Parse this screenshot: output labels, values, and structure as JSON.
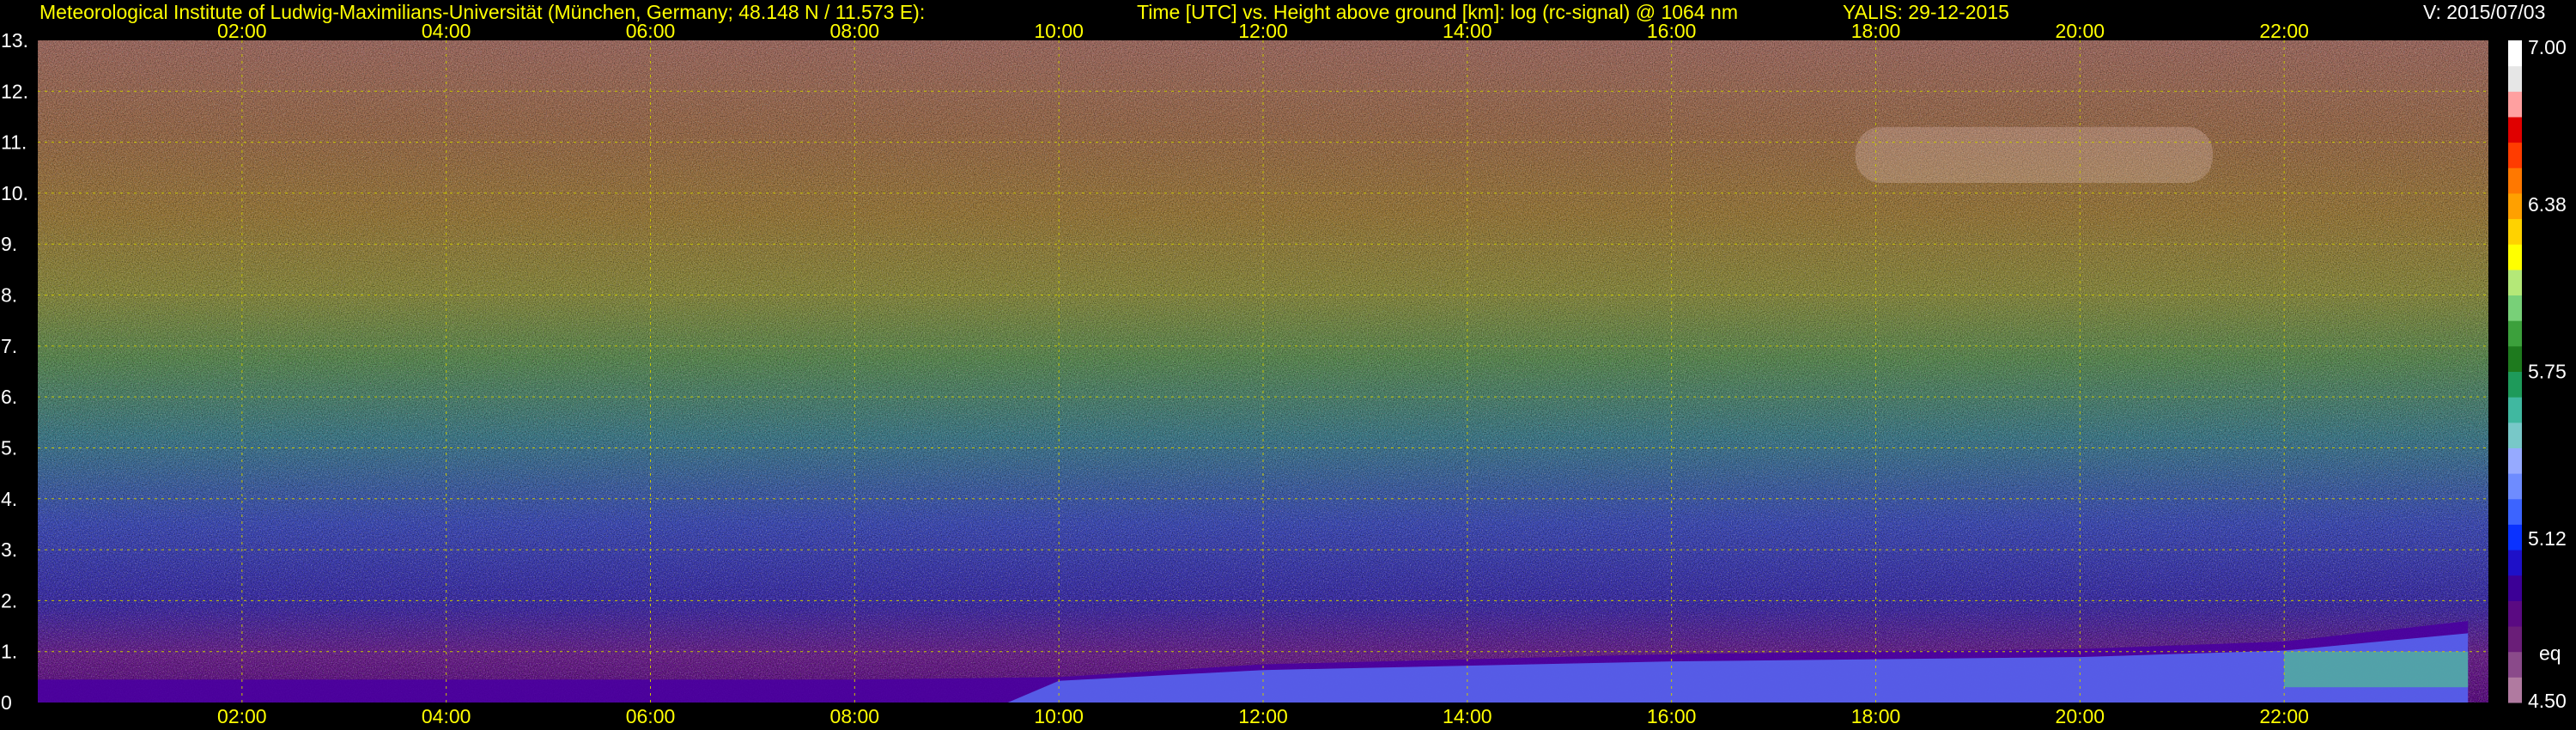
{
  "header": {
    "institute": "Meteorological Institute of Ludwig-Maximilians-Universität (München, Germany; 48.148 N / 11.573 E):",
    "plot_desc": "Time [UTC] vs. Height above ground [km]: log (rc-signal) @ 1064 nm",
    "station_date": "YALIS: 29-12-2015",
    "version": "V: 2015/07/03"
  },
  "colors": {
    "header_text": "#ffff00",
    "axis_text": "#ffffff",
    "grid": "#c8c800",
    "background": "#000000"
  },
  "chart_data": {
    "type": "heatmap",
    "title": "Time [UTC] vs. Height above ground [km]: log (rc-signal) @ 1064 nm",
    "xlabel": "Time [UTC]",
    "ylabel": "Height above ground [km]",
    "x_ticks": [
      "02:00",
      "04:00",
      "06:00",
      "08:00",
      "10:00",
      "12:00",
      "14:00",
      "16:00",
      "18:00",
      "20:00",
      "22:00"
    ],
    "x_tick_hours": [
      2,
      4,
      6,
      8,
      10,
      12,
      14,
      16,
      18,
      20,
      22
    ],
    "xlim_hours": [
      0,
      24
    ],
    "y_ticks": [
      "0",
      "1.",
      "2.",
      "3.",
      "4.",
      "5.",
      "6.",
      "7.",
      "8.",
      "9.",
      "10.",
      "11.",
      "12.",
      "13."
    ],
    "y_tick_values": [
      0,
      1,
      2,
      3,
      4,
      5,
      6,
      7,
      8,
      9,
      10,
      11,
      12,
      13
    ],
    "ylim_km": [
      0,
      13
    ],
    "grid": true,
    "colorbar": {
      "range": [
        4.5,
        7.0
      ],
      "tick_labels": [
        "7.00",
        "6.38",
        "5.75",
        "5.12",
        "4.50"
      ],
      "tick_values": [
        7.0,
        6.38,
        5.75,
        5.12,
        4.5
      ],
      "extra_label": "eq",
      "extra_value": 4.66,
      "colors": [
        "#b07aa0",
        "#8a4a8a",
        "#6a1e78",
        "#5a0a82",
        "#3c0096",
        "#1e10c8",
        "#0a32ff",
        "#3c64ff",
        "#6e8cff",
        "#96aaff",
        "#78c8c8",
        "#40b8a0",
        "#1e9a5a",
        "#1e7a1e",
        "#3ca03c",
        "#78d078",
        "#b4e878",
        "#ffff00",
        "#ffd200",
        "#ffa000",
        "#ff7800",
        "#ff3c00",
        "#e00000",
        "#ffa0a0",
        "#e6e6e6",
        "#ffffff"
      ]
    },
    "features": {
      "boundary_layer_top_km": [
        {
          "hour": 0.0,
          "km": 0.45
        },
        {
          "hour": 8.0,
          "km": 0.45
        },
        {
          "hour": 10.0,
          "km": 0.5
        },
        {
          "hour": 12.0,
          "km": 0.75
        },
        {
          "hour": 14.0,
          "km": 0.85
        },
        {
          "hour": 16.0,
          "km": 0.95
        },
        {
          "hour": 18.0,
          "km": 1.0
        },
        {
          "hour": 20.0,
          "km": 1.05
        },
        {
          "hour": 22.0,
          "km": 1.2
        },
        {
          "hour": 23.8,
          "km": 1.6
        }
      ],
      "cloud_layer_km": [
        10.2,
        11.3
      ],
      "cloud_layer_hours": [
        17.8,
        21.3
      ]
    }
  }
}
